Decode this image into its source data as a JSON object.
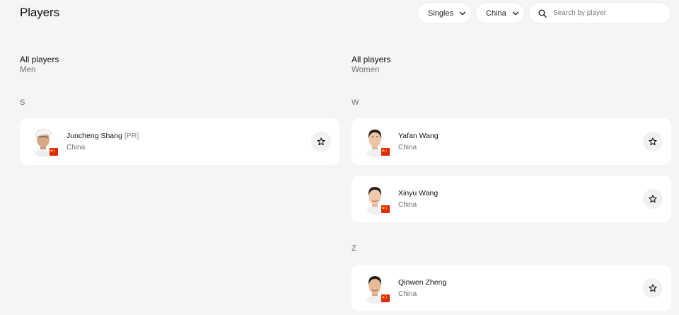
{
  "header": {
    "title": "Players"
  },
  "filters": {
    "type_label": "Singles",
    "country_label": "China",
    "search_placeholder": "Search by player"
  },
  "men": {
    "title": "All players",
    "subtitle": "Men",
    "groups": [
      {
        "letter": "S",
        "players": [
          {
            "name": "Juncheng Shang",
            "tag": "[PR]",
            "country": "China"
          }
        ]
      }
    ]
  },
  "women": {
    "title": "All players",
    "subtitle": "Women",
    "groups": [
      {
        "letter": "W",
        "players": [
          {
            "name": "Yafan Wang",
            "country": "China"
          },
          {
            "name": "Xinyu Wang",
            "country": "China"
          }
        ]
      },
      {
        "letter": "Z",
        "players": [
          {
            "name": "Qinwen Zheng",
            "country": "China"
          }
        ]
      }
    ]
  },
  "colors": {
    "flag_red": "#de2910",
    "flag_yellow": "#ffde00"
  },
  "icons": {
    "dropdown": "chevron-down-icon",
    "search": "search-icon",
    "favorite": "star-icon",
    "flag": "china-flag-icon"
  }
}
